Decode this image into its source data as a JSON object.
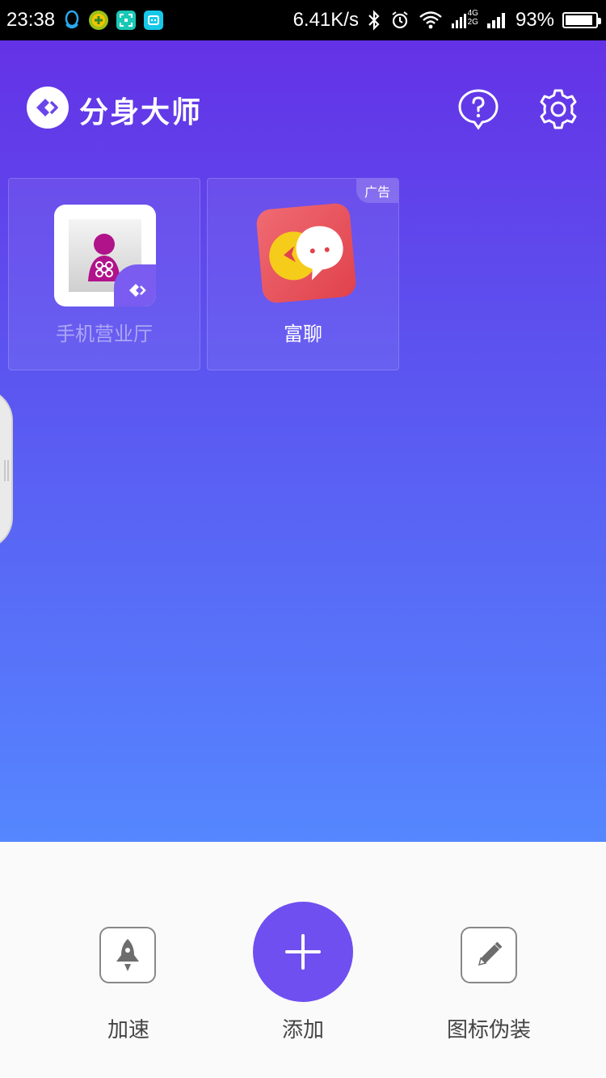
{
  "status_bar": {
    "time": "23:38",
    "net_speed": "6.41K/s",
    "network_type_top": "4G",
    "network_type_bottom": "2G",
    "battery": "93%",
    "battery_level": 0.93
  },
  "header": {
    "title": "分身大师",
    "help_icon": "question-bubble-icon",
    "settings_icon": "gear-icon"
  },
  "apps": [
    {
      "label": "手机营业厅",
      "icon": "china-unicom-icon",
      "cloned": true
    },
    {
      "label": "富聊",
      "icon": "fuliao-chat-icon",
      "ad": "广告"
    }
  ],
  "bottom_bar": {
    "speed_label": "加速",
    "add_label": "添加",
    "disguise_label": "图标伪装"
  },
  "colors": {
    "gradient_top": "#6432e6",
    "gradient_bottom": "#5587ff",
    "accent": "#6f4ff0"
  }
}
